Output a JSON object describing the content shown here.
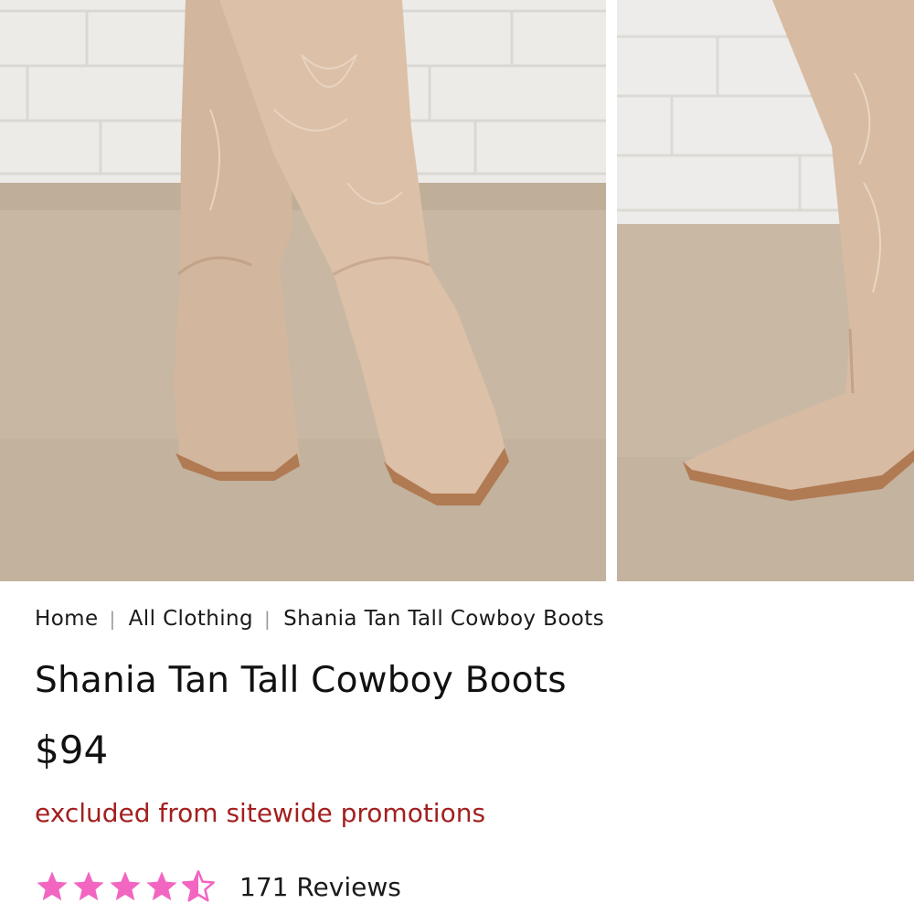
{
  "breadcrumb": {
    "home": "Home",
    "separator": "|",
    "category": "All Clothing",
    "current": "Shania Tan Tall Cowboy Boots"
  },
  "product": {
    "title": "Shania Tan Tall Cowboy Boots",
    "price": "$94",
    "promo_note": "excluded from sitewide promotions",
    "rating": {
      "value": 4.5,
      "max": 5,
      "reviews_label": "171 Reviews"
    }
  },
  "gallery": {
    "images": [
      {
        "alt": "Tan tall cowboy boots, front view"
      },
      {
        "alt": "Tan tall cowboy boot, side view"
      }
    ]
  },
  "colors": {
    "star": "#f266c1",
    "promo": "#a3201f",
    "text": "#111111"
  },
  "icons": {
    "star_full": "star-full-icon",
    "star_half": "star-half-icon"
  }
}
